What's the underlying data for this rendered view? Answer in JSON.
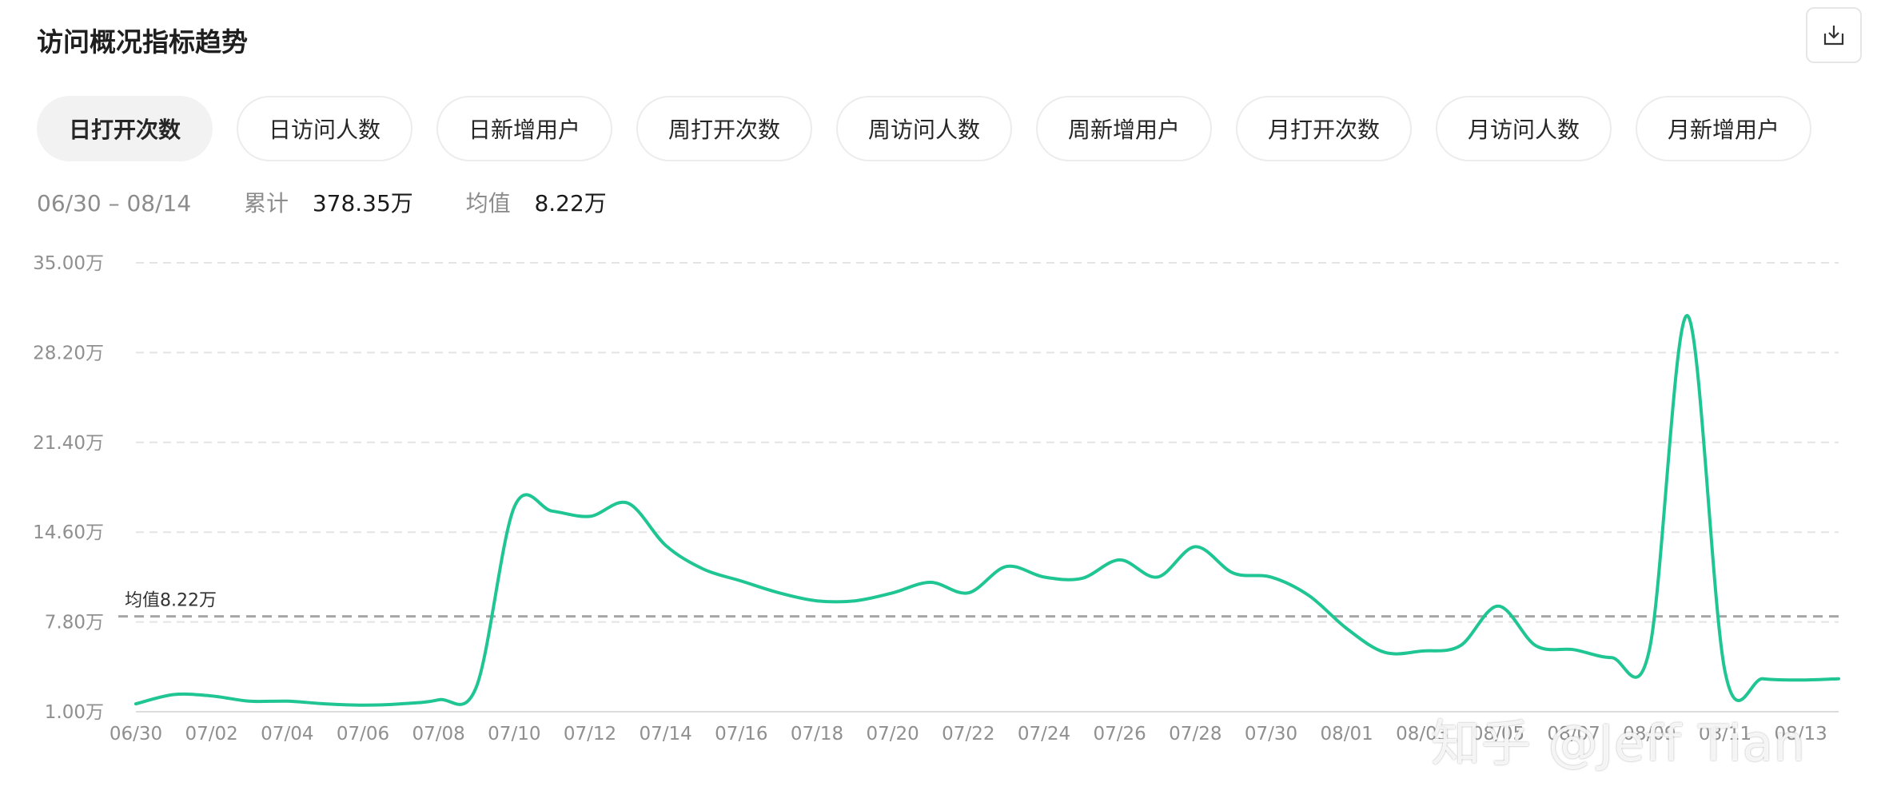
{
  "header": {
    "title": "访问概况指标趋势",
    "export_icon": "download-icon"
  },
  "tabs": [
    {
      "label": "日打开次数",
      "active": true
    },
    {
      "label": "日访问人数",
      "active": false
    },
    {
      "label": "日新增用户",
      "active": false
    },
    {
      "label": "周打开次数",
      "active": false
    },
    {
      "label": "周访问人数",
      "active": false
    },
    {
      "label": "周新增用户",
      "active": false
    },
    {
      "label": "月打开次数",
      "active": false
    },
    {
      "label": "月访问人数",
      "active": false
    },
    {
      "label": "月新增用户",
      "active": false
    }
  ],
  "summary": {
    "range": "06/30 – 08/14",
    "total_label": "累计",
    "total_value": "378.35万",
    "avg_label": "均值",
    "avg_value": "8.22万"
  },
  "watermark": "知乎 @Jeff Tian",
  "colors": {
    "line": "#1fc592",
    "grid": "#e4e4e4",
    "avg": "#a6a6a6"
  },
  "chart_data": {
    "type": "line",
    "ylim": [
      1.0,
      35.0
    ],
    "yticks": [
      1.0,
      7.8,
      14.6,
      21.4,
      28.2,
      35.0
    ],
    "ytick_labels": [
      "1.00万",
      "7.80万",
      "14.60万",
      "21.40万",
      "28.20万",
      "35.00万"
    ],
    "xtick_labels": [
      "06/30",
      "07/02",
      "07/04",
      "07/06",
      "07/08",
      "07/10",
      "07/12",
      "07/14",
      "07/16",
      "07/18",
      "07/20",
      "07/22",
      "07/24",
      "07/26",
      "07/28",
      "07/30",
      "08/01",
      "08/03",
      "08/05",
      "08/07",
      "08/09",
      "08/11",
      "08/13"
    ],
    "average": 8.22,
    "average_label": "均值8.22万",
    "series": [
      {
        "x": [
          "06/30",
          "07/01",
          "07/02",
          "07/03",
          "07/04",
          "07/05",
          "07/06",
          "07/07",
          "07/08",
          "07/09",
          "07/10",
          "07/11",
          "07/12",
          "07/13",
          "07/14",
          "07/15",
          "07/16",
          "07/17",
          "07/18",
          "07/19",
          "07/20",
          "07/21",
          "07/22",
          "07/23",
          "07/24",
          "07/25",
          "07/26",
          "07/27",
          "07/28",
          "07/29",
          "07/30",
          "07/31",
          "08/01",
          "08/02",
          "08/03",
          "08/04",
          "08/05",
          "08/06",
          "08/07",
          "08/08",
          "08/09",
          "08/10",
          "08/11",
          "08/12",
          "08/13",
          "08/14"
        ],
        "values": [
          1.6,
          2.3,
          2.2,
          1.8,
          1.8,
          1.6,
          1.5,
          1.6,
          1.9,
          2.9,
          16.5,
          16.2,
          15.8,
          16.8,
          13.6,
          11.8,
          10.9,
          10.0,
          9.4,
          9.4,
          10.0,
          10.8,
          10.0,
          12.0,
          11.2,
          11.1,
          12.5,
          11.2,
          13.5,
          11.5,
          11.2,
          9.8,
          7.3,
          5.5,
          5.6,
          6.0,
          9.0,
          6.0,
          5.7,
          5.1,
          5.7,
          31.0,
          4.0,
          3.5,
          3.4,
          3.5
        ]
      }
    ]
  }
}
